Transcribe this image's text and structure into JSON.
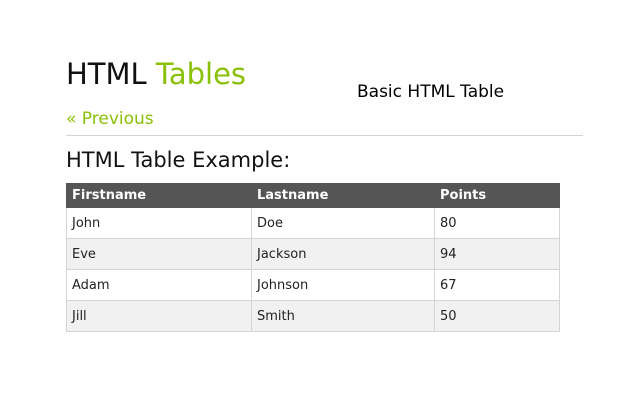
{
  "header": {
    "title_part1": "HTML",
    "title_part2": "Tables",
    "subtitle": "Basic HTML Table",
    "previous_link": "« Previous"
  },
  "content": {
    "section_title": "HTML Table Example:"
  },
  "table": {
    "columns": [
      "Firstname",
      "Lastname",
      "Points"
    ],
    "rows": [
      [
        "John",
        "Doe",
        "80"
      ],
      [
        "Eve",
        "Jackson",
        "94"
      ],
      [
        "Adam",
        "Johnson",
        "67"
      ],
      [
        "Jill",
        "Smith",
        "50"
      ]
    ]
  },
  "colors": {
    "accent": "#8ac007",
    "table_header_bg": "#555555",
    "table_stripe_bg": "#f1f1f1",
    "border": "#d4d4d4"
  }
}
